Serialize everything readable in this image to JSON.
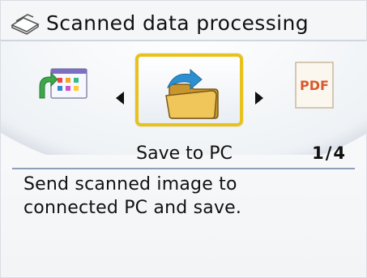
{
  "header": {
    "title": "Scanned data processing",
    "icon": "scanner-icon"
  },
  "carousel": {
    "left_item": {
      "icon": "forward-to-app-icon"
    },
    "selected_item": {
      "icon": "folder-save-icon",
      "label": "Save to PC"
    },
    "right_item": {
      "icon": "pdf-document-icon",
      "text": "PDF"
    },
    "page_indicator": "1/4"
  },
  "description": {
    "line1": "Send scanned image to",
    "line2": "connected PC and save."
  },
  "colors": {
    "selection_border": "#e8c21b",
    "folder": "#f0c65a",
    "arrow_blue": "#2c8fd0",
    "pdf_text": "#d85a2a"
  }
}
